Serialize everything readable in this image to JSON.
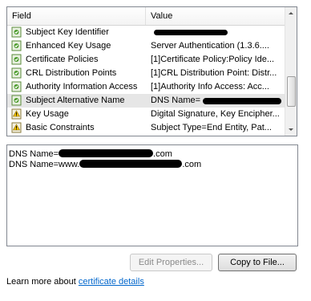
{
  "fields_list": {
    "columns": {
      "field": "Field",
      "value": "Value"
    },
    "rows": [
      {
        "field": "Subject Key Identifier",
        "value": "",
        "icon": "certificate-extension-icon"
      },
      {
        "field": "Enhanced Key Usage",
        "value": "Server Authentication (1.3.6....",
        "icon": "certificate-extension-icon"
      },
      {
        "field": "Certificate Policies",
        "value": "[1]Certificate Policy:Policy Ide...",
        "icon": "certificate-extension-icon"
      },
      {
        "field": "CRL Distribution Points",
        "value": "[1]CRL Distribution Point: Distr...",
        "icon": "certificate-extension-icon"
      },
      {
        "field": "Authority Information Access",
        "value": "[1]Authority Info Access: Acc...",
        "icon": "certificate-extension-icon"
      },
      {
        "field": "Subject Alternative Name",
        "value": "DNS Name=",
        "icon": "certificate-extension-icon"
      },
      {
        "field": "Key Usage",
        "value": "Digital Signature, Key Encipher...",
        "icon": "critical-extension-warning-icon"
      },
      {
        "field": "Basic Constraints",
        "value": "Subject Type=End Entity, Pat...",
        "icon": "critical-extension-warning-icon"
      }
    ],
    "selected_index": 5
  },
  "details": {
    "lines": [
      {
        "prefix": "DNS Name=",
        "suffix": ".com"
      },
      {
        "prefix": "DNS Name=www.",
        "suffix": ".com"
      }
    ]
  },
  "buttons": {
    "edit_properties": "Edit Properties...",
    "copy_to_file": "Copy to File..."
  },
  "footer": {
    "text": "Learn more about ",
    "link": "certificate details"
  }
}
